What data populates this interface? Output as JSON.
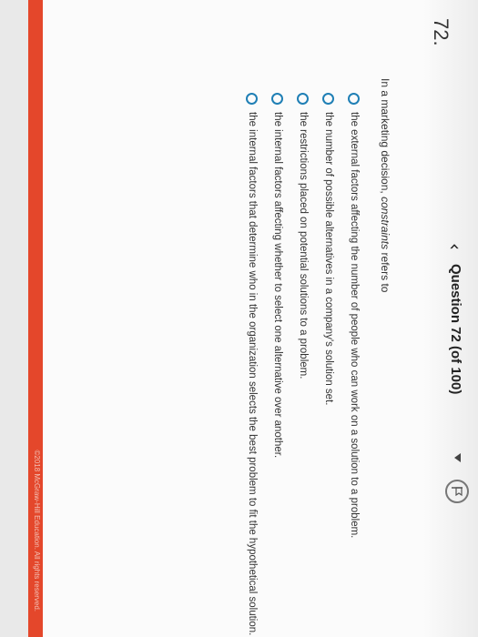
{
  "header": {
    "prev_icon": "chevron-left-icon",
    "question_label": "Question 72 (of 100)",
    "dropdown_icon": "caret-down-icon",
    "flag_icon": "flag-icon"
  },
  "question": {
    "number": "72.",
    "prompt_before": "In a marketing decision, ",
    "prompt_emphasis": "constraints",
    "prompt_after": " refers to",
    "options": [
      "the external factors affecting the number of people who can work on a solution to a problem.",
      "the number of possible alternatives in a company's solution set.",
      "the restrictions placed on potential solutions to a problem.",
      "the internal factors affecting whether to select one alternative over another.",
      "the internal factors that determine who in the organization selects the best problem to fit the hypothetical solution."
    ]
  },
  "footer": {
    "copyright": "©2018 McGraw-Hill Education. All rights reserved."
  },
  "colors": {
    "accent": "#1f7fb5",
    "footer_bar": "#e4472b"
  }
}
